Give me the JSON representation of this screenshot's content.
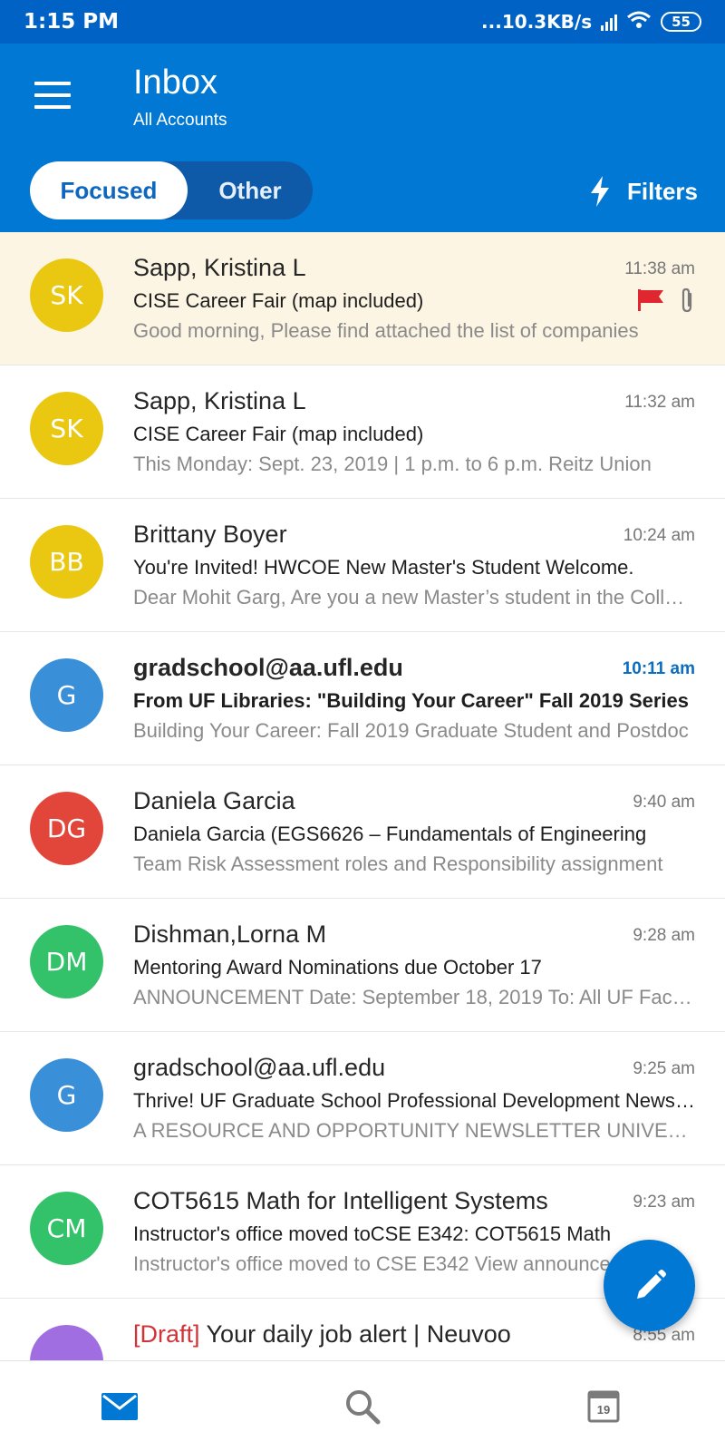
{
  "status_bar": {
    "time": "1:15 PM",
    "speed": "...10.3KB/s",
    "battery": "55"
  },
  "header": {
    "title": "Inbox",
    "subtitle": "All Accounts",
    "tabs": [
      {
        "label": "Focused",
        "active": true
      },
      {
        "label": "Other",
        "active": false
      }
    ],
    "filters_label": "Filters"
  },
  "emails": [
    {
      "initials": "SK",
      "avatar_color": "#eac812",
      "sender": "Sapp, Kristina L",
      "time": "11:38 am",
      "subject": "CISE Career Fair (map included)",
      "preview": "Good morning, Please find attached the list of companies",
      "flagged": true,
      "attachment": true,
      "unread": false,
      "highlighted": true
    },
    {
      "initials": "SK",
      "avatar_color": "#eac812",
      "sender": "Sapp, Kristina L",
      "time": "11:32 am",
      "subject": "CISE Career Fair (map included)",
      "preview": "This Monday: Sept. 23, 2019 | 1 p.m. to 6 p.m. Reitz Union",
      "flagged": false,
      "attachment": false,
      "unread": false,
      "highlighted": false
    },
    {
      "initials": "BB",
      "avatar_color": "#eac812",
      "sender": "Brittany Boyer",
      "time": "10:24 am",
      "subject": "You're Invited! HWCOE New Master's Student Welcome.",
      "preview": "Dear Mohit Garg, Are you a new Master’s student in the College",
      "flagged": false,
      "attachment": false,
      "unread": false,
      "highlighted": false
    },
    {
      "initials": "G",
      "avatar_color": "#3a8fd9",
      "sender": "gradschool@aa.ufl.edu",
      "time": "10:11 am",
      "subject": "From UF Libraries: \"Building Your Career\" Fall 2019 Series",
      "preview": "Building Your Career: Fall 2019 Graduate Student and Postdoc",
      "flagged": false,
      "attachment": false,
      "unread": true,
      "highlighted": false
    },
    {
      "initials": "DG",
      "avatar_color": "#e2463a",
      "sender": "Daniela Garcia",
      "time": "9:40 am",
      "subject": "Daniela Garcia (EGS6626 – Fundamentals of Engineering",
      "preview": "Team Risk Assessment roles and Responsibility assignment",
      "flagged": false,
      "attachment": false,
      "unread": false,
      "highlighted": false
    },
    {
      "initials": "DM",
      "avatar_color": "#33c26a",
      "sender": "Dishman,Lorna M",
      "time": "9:28 am",
      "subject": "Mentoring Award Nominations due October 17",
      "preview": "ANNOUNCEMENT Date: September 18, 2019 To: All UF Faculty",
      "flagged": false,
      "attachment": false,
      "unread": false,
      "highlighted": false
    },
    {
      "initials": "G",
      "avatar_color": "#3a8fd9",
      "sender": "gradschool@aa.ufl.edu",
      "time": "9:25 am",
      "subject": "Thrive! UF Graduate School Professional Development Newsletter",
      "preview": "A RESOURCE AND OPPORTUNITY NEWSLETTER UNIVERSITY",
      "flagged": false,
      "attachment": false,
      "unread": false,
      "highlighted": false
    },
    {
      "initials": "CM",
      "avatar_color": "#33c26a",
      "sender": "COT5615 Math for Intelligent Systems",
      "time": "9:23 am",
      "subject": "Instructor's office moved toCSE  E342: COT5615 Math",
      "preview": "Instructor's office moved to CSE E342 View announcement",
      "flagged": false,
      "attachment": false,
      "unread": false,
      "highlighted": false
    },
    {
      "initials": "",
      "avatar_color": "#a06ee0",
      "draft_tag": "[Draft]",
      "sender": "Your daily job alert | Neuvoo",
      "time": "8:55 am",
      "subject": "",
      "preview": "",
      "flagged": false,
      "attachment": false,
      "unread": false,
      "highlighted": false
    }
  ],
  "bottom_nav": {
    "items": [
      {
        "icon": "mail-icon",
        "active": true
      },
      {
        "icon": "search-icon",
        "active": false
      },
      {
        "icon": "calendar-icon",
        "label": "19",
        "active": false
      }
    ]
  },
  "colors": {
    "brand": "#0078d4",
    "status_bar": "#0062c4",
    "highlight_row": "#fcf5e3",
    "flag": "#e0262e"
  }
}
